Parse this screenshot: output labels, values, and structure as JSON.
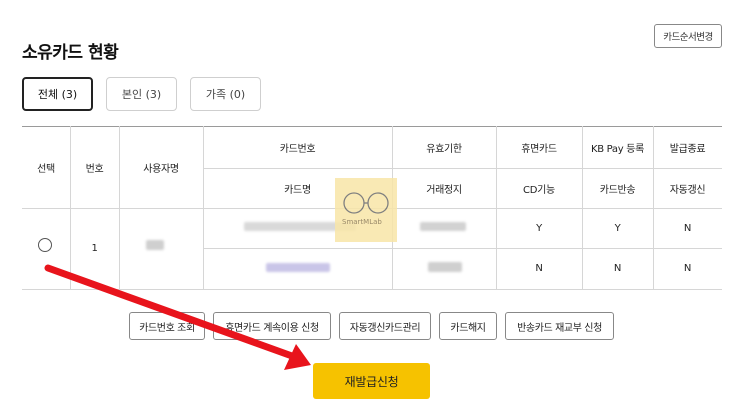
{
  "page": {
    "title": "소유카드 현황",
    "card_order_button": "카드순서변경"
  },
  "tabs": [
    {
      "label": "전체 (3)",
      "active": true
    },
    {
      "label": "본인 (3)",
      "active": false
    },
    {
      "label": "가족 (0)",
      "active": false
    }
  ],
  "table": {
    "headers": {
      "select": "선택",
      "number": "번호",
      "user_name": "사용자명",
      "card_number": "카드번호",
      "card_name": "카드명",
      "expiry": "유효기한",
      "transaction_stop": "거래정지",
      "dormant_card": "휴면카드",
      "cd_function": "CD기능",
      "kbpay_register": "KB Pay 등록",
      "card_return": "카드반송",
      "issue_end": "발급종료",
      "auto_renew": "자동갱신"
    },
    "row": {
      "number": "1",
      "dormant_card": "Y",
      "kbpay_register": "Y",
      "issue_end": "N",
      "cd_function": "N",
      "card_return": "N",
      "auto_renew": "N"
    }
  },
  "watermark": "SmartMLab",
  "actions": [
    "카드번호 조회",
    "휴면카드 계속이용 신청",
    "자동갱신카드관리",
    "카드해지",
    "반송카드 재교부 신청"
  ],
  "primary_action": "재발급신청",
  "colors": {
    "accent": "#f6c200",
    "arrow": "#e8141c"
  }
}
